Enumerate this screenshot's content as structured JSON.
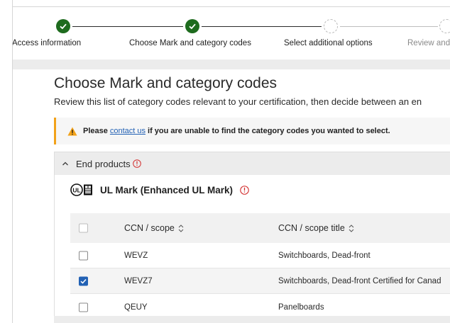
{
  "stepper": {
    "steps": [
      {
        "label": "Access information",
        "status": "complete"
      },
      {
        "label": "Choose Mark and category codes",
        "status": "complete"
      },
      {
        "label": "Select additional options",
        "status": "pending"
      },
      {
        "label": "Review and",
        "status": "pending"
      }
    ]
  },
  "page": {
    "title": "Choose Mark and category codes",
    "description": "Review this list of category codes relevant to your certification, then decide between an en"
  },
  "alert": {
    "prefix": "Please",
    "link": "contact us",
    "suffix": "if you are unable to find the category codes you wanted to select."
  },
  "panel": {
    "section_label": "End products",
    "mark_label": "UL Mark (Enhanced UL Mark)",
    "table": {
      "headers": {
        "ccn": "CCN / scope",
        "title": "CCN / scope title"
      },
      "rows": [
        {
          "ccn": "WEVZ",
          "title": "Switchboards, Dead-front",
          "checked": false
        },
        {
          "ccn": "WEVZ7",
          "title": "Switchboards, Dead-front Certified for Canad",
          "checked": true
        },
        {
          "ccn": "QEUY",
          "title": "Panelboards",
          "checked": false
        }
      ]
    }
  },
  "colors": {
    "complete": "#1e6b1e",
    "accent": "#2261b4",
    "warning": "#f2a21a",
    "error": "#d32f2f"
  },
  "icons": [
    "check-icon",
    "warning-icon",
    "chevron-up-icon",
    "info-icon",
    "ul-mark-logo",
    "sort-icon",
    "checkbox-icon"
  ]
}
